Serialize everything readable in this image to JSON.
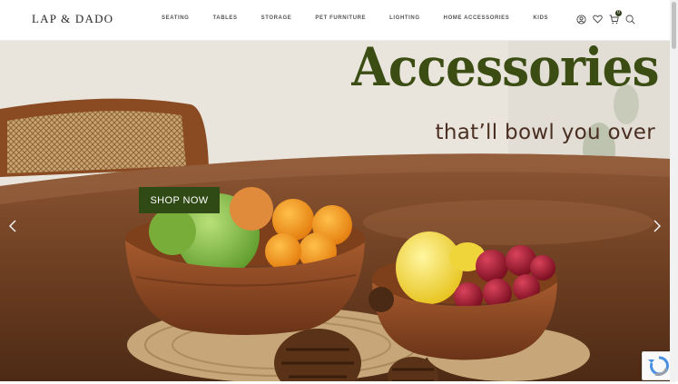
{
  "header": {
    "logo": "LAP & DADO",
    "nav": [
      {
        "label": "SEATING"
      },
      {
        "label": "TABLES"
      },
      {
        "label": "STORAGE"
      },
      {
        "label": "PET FURNITURE"
      },
      {
        "label": "LIGHTING"
      },
      {
        "label": "HOME ACCESSORIES"
      },
      {
        "label": "KIDS"
      }
    ],
    "icons": [
      "user-icon",
      "heart-icon",
      "cart-icon",
      "search-icon"
    ],
    "cart_count": "0"
  },
  "hero": {
    "headline": "Accessories",
    "subline": "that’ll bowl you over",
    "cta_label": "SHOP NOW",
    "colors": {
      "headline": "#3c4d14",
      "subline": "#4a2f22",
      "cta": "#2f4a14"
    }
  }
}
